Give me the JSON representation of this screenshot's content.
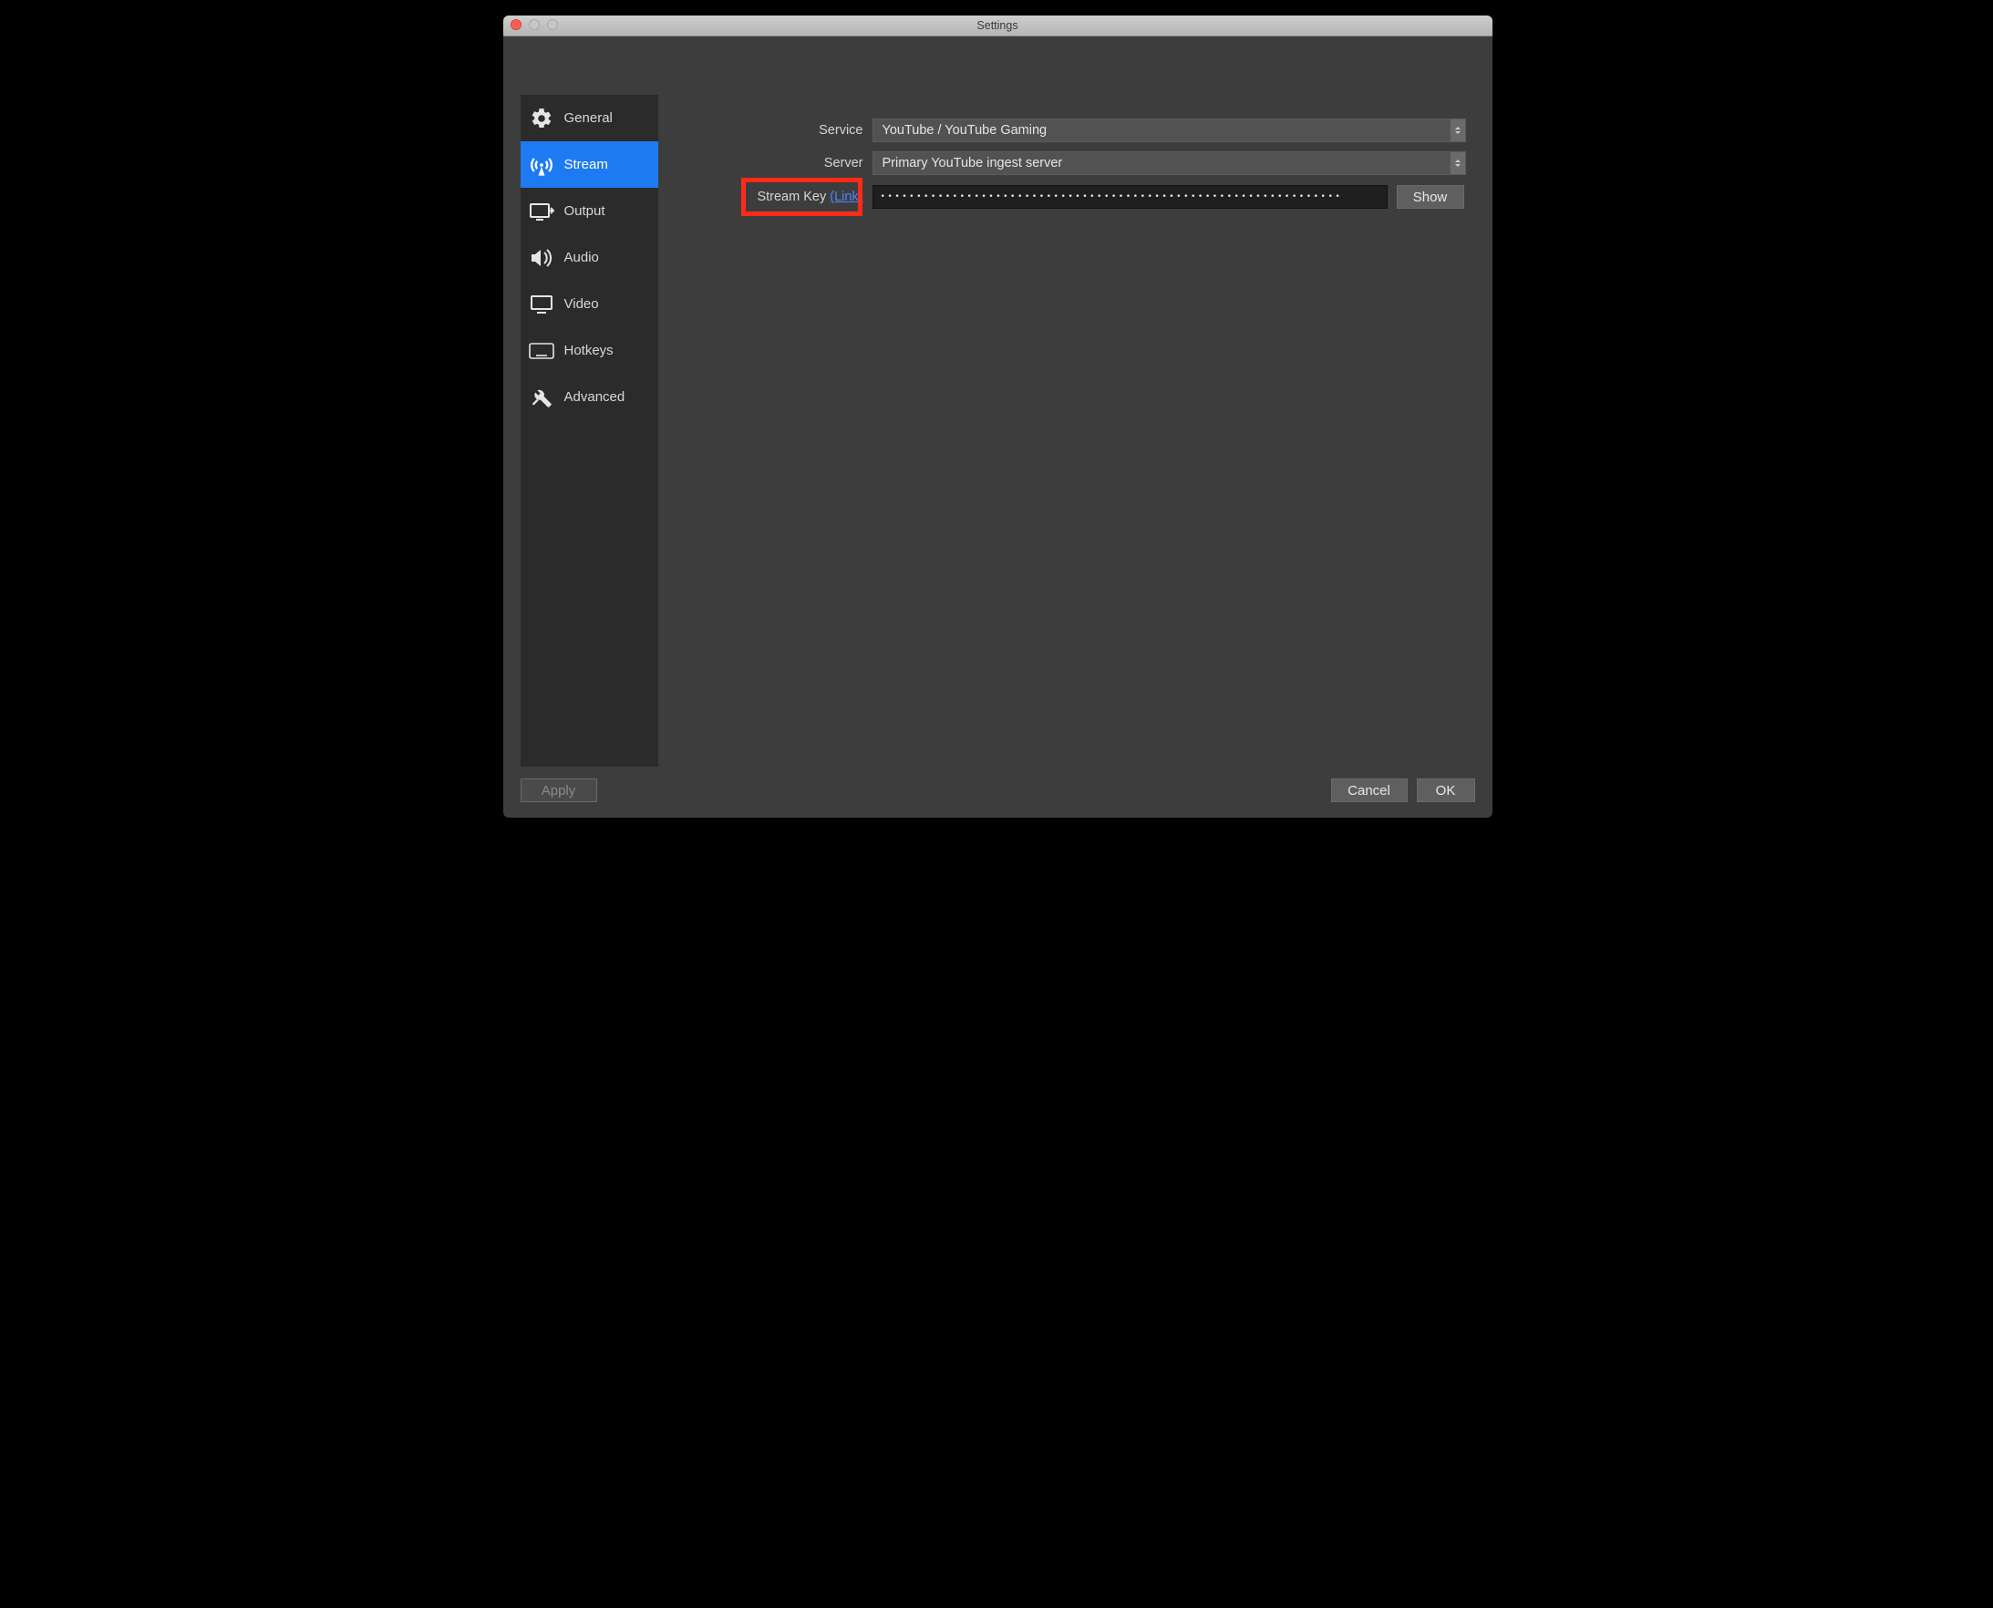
{
  "window": {
    "title": "Settings"
  },
  "sidebar": {
    "items": [
      {
        "label": "General"
      },
      {
        "label": "Stream"
      },
      {
        "label": "Output"
      },
      {
        "label": "Audio"
      },
      {
        "label": "Video"
      },
      {
        "label": "Hotkeys"
      },
      {
        "label": "Advanced"
      }
    ],
    "selected_index": 1
  },
  "form": {
    "service_label": "Service",
    "service_value": "YouTube / YouTube Gaming",
    "server_label": "Server",
    "server_value": "Primary YouTube ingest server",
    "streamkey_label": "Stream Key ",
    "streamkey_link": "(Link)",
    "streamkey_value": "••••••••••••••••••••••••••••••••••••••••••••••••••••••••••••••••",
    "show_label": "Show"
  },
  "buttons": {
    "apply": "Apply",
    "cancel": "Cancel",
    "ok": "OK"
  }
}
